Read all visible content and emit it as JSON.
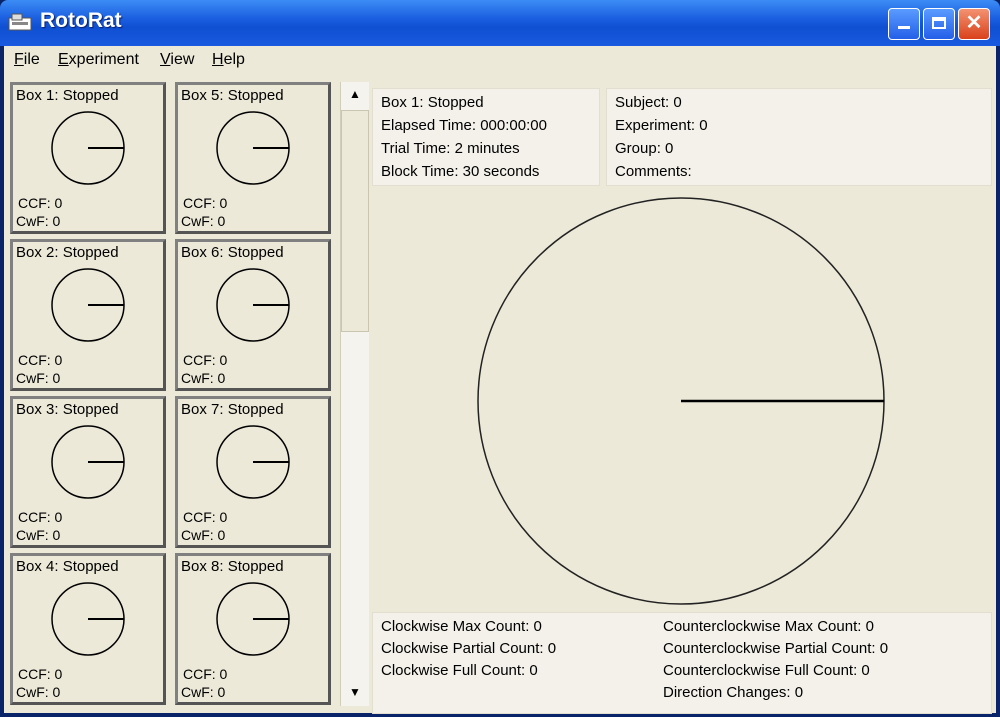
{
  "window": {
    "title": "RotoRat",
    "minimize_icon": "minimize-icon",
    "maximize_icon": "maximize-icon",
    "close_icon": "close-icon"
  },
  "menu": [
    {
      "label": "File",
      "u": "F",
      "rest": "ile"
    },
    {
      "label": "Experiment",
      "u": "E",
      "rest": "xperiment"
    },
    {
      "label": "View",
      "u": "V",
      "rest": "iew"
    },
    {
      "label": "Help",
      "u": "H",
      "rest": "elp"
    }
  ],
  "boxes": [
    {
      "title": "Box 1: Stopped",
      "ccf": "CCF: 0",
      "cwf": "CwF: 0"
    },
    {
      "title": "Box 5: Stopped",
      "ccf": "CCF: 0",
      "cwf": "CwF: 0"
    },
    {
      "title": "Box 2: Stopped",
      "ccf": "CCF: 0",
      "cwf": "CwF: 0"
    },
    {
      "title": "Box 6: Stopped",
      "ccf": "CCF: 0",
      "cwf": "CwF: 0"
    },
    {
      "title": "Box 3: Stopped",
      "ccf": "CCF: 0",
      "cwf": "CwF: 0"
    },
    {
      "title": "Box 7: Stopped",
      "ccf": "CCF: 0",
      "cwf": "CwF: 0"
    },
    {
      "title": "Box 4: Stopped",
      "ccf": "CCF: 0",
      "cwf": "CwF: 0"
    },
    {
      "title": "Box 8: Stopped",
      "ccf": "CCF: 0",
      "cwf": "CwF: 0"
    }
  ],
  "status": {
    "box": "Box 1: Stopped",
    "elapsed": "Elapsed Time: 000:00:00",
    "trial": "Trial Time: 2 minutes",
    "block": "Block Time: 30 seconds"
  },
  "subject": {
    "subject": "Subject: 0",
    "experiment": "Experiment: 0",
    "group": "Group: 0",
    "comments": "Comments:"
  },
  "counts": {
    "cw_max": "Clockwise Max Count: 0",
    "cw_partial": "Clockwise Partial Count: 0",
    "cw_full": "Clockwise Full Count: 0",
    "ccw_max": "Counterclockwise Max Count: 0",
    "ccw_partial": "Counterclockwise Partial Count: 0",
    "ccw_full": "Counterclockwise Full Count: 0",
    "direction_changes": "Direction Changes: 0"
  },
  "scrollbar": {
    "up_icon": "▲",
    "down_icon": "▼"
  }
}
